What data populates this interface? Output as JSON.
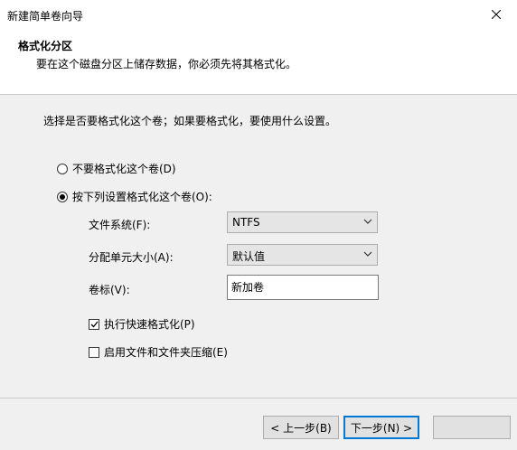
{
  "window": {
    "title": "新建简单卷向导"
  },
  "header": {
    "title": "格式化分区",
    "subtitle": "要在这个磁盘分区上储存数据，你必须先将其格式化。"
  },
  "content": {
    "instruction": "选择是否要格式化这个卷；如果要格式化，要使用什么设置。",
    "radio_no_format": "不要格式化这个卷(D)",
    "radio_format": "按下列设置格式化这个卷(O):",
    "fs_label": "文件系统(F):",
    "fs_value": "NTFS",
    "alloc_label": "分配单元大小(A):",
    "alloc_value": "默认值",
    "vol_label": "卷标(V):",
    "vol_value": "新加卷",
    "quick_format": "执行快速格式化(P)",
    "compression": "启用文件和文件夹压缩(E)"
  },
  "buttons": {
    "back": "< 上一步(B)",
    "next": "下一步(N) >"
  }
}
